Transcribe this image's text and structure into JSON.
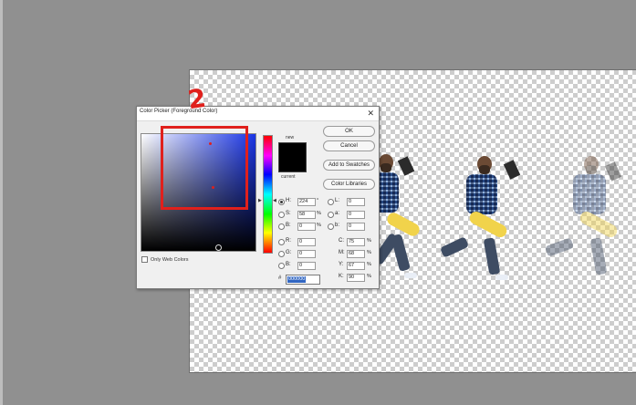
{
  "dialog": {
    "title": "Color Picker (Foreground Color)",
    "close_icon": "close-icon",
    "new_label": "new",
    "current_label": "current",
    "buttons": {
      "ok": "OK",
      "cancel": "Cancel",
      "add": "Add to Swatches",
      "libraries": "Color Libraries"
    },
    "only_web_colors": "Only Web Colors",
    "hex_prefix": "#",
    "hex_value": "000000",
    "fields_left": [
      {
        "label": "H:",
        "value": "224",
        "unit": "°",
        "selected": true
      },
      {
        "label": "S:",
        "value": "58",
        "unit": "%",
        "selected": false
      },
      {
        "label": "B:",
        "value": "0",
        "unit": "%",
        "selected": false
      },
      {
        "label": "R:",
        "value": "0",
        "unit": "",
        "selected": false
      },
      {
        "label": "G:",
        "value": "0",
        "unit": "",
        "selected": false
      },
      {
        "label": "B:",
        "value": "0",
        "unit": "",
        "selected": false
      }
    ],
    "fields_lab": [
      {
        "label": "L:",
        "value": "0"
      },
      {
        "label": "a:",
        "value": "0"
      },
      {
        "label": "b:",
        "value": "0"
      }
    ],
    "fields_cmyk": [
      {
        "label": "C:",
        "value": "75",
        "unit": "%"
      },
      {
        "label": "M:",
        "value": "68",
        "unit": "%"
      },
      {
        "label": "Y:",
        "value": "67",
        "unit": "%"
      },
      {
        "label": "K:",
        "value": "90",
        "unit": "%"
      }
    ]
  },
  "annotation": {
    "number": "2",
    "color": "#e0201c"
  },
  "colors": {
    "field_hue": "#1a35e6",
    "swatch": "#000000",
    "canvas_bg": "#909090"
  }
}
